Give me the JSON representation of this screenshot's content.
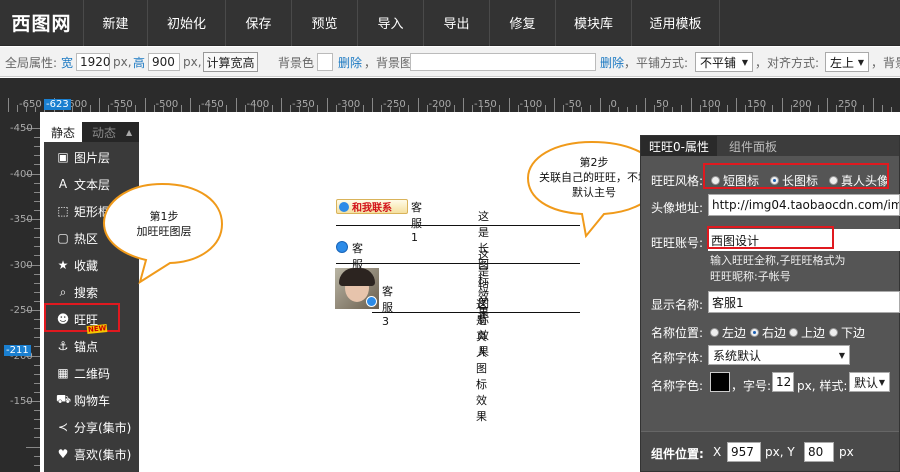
{
  "logo": "西图网",
  "menu": [
    "新建",
    "初始化",
    "保存",
    "预览",
    "导入",
    "导出",
    "修复",
    "模块库",
    "适用模板"
  ],
  "global": {
    "label": "全局属性:",
    "width_label": "宽",
    "width_value": "1920",
    "px1": "px,",
    "height_label": "高",
    "height_value": "900",
    "px2": "px,",
    "calc_button": "计算宽高",
    "bg_color_label": "背景色",
    "delete1": "删除",
    "bg_image_label": "，背景图",
    "delete2": "删除",
    "tile_label": "，平铺方式:",
    "tile_value": "不平铺",
    "align_label": "，对齐方式:",
    "align_value": "左上",
    "bg_tail": "，背景"
  },
  "hruler": {
    "labels": [
      "-650",
      "-600",
      "-550",
      "-500",
      "-450",
      "-400",
      "-350",
      "-300",
      "-250",
      "-200",
      "-150",
      "-100",
      "-50",
      "0",
      "50",
      "100",
      "150",
      "200",
      "250"
    ],
    "marker": "-623"
  },
  "vruler": {
    "labels": [
      "-450",
      "-400",
      "-350",
      "-300",
      "-250",
      "-200",
      "-150"
    ],
    "marker": "-211"
  },
  "layer_panel": {
    "tab_static": "静态",
    "tab_dynamic": "动态",
    "items": [
      {
        "icon": "image-icon",
        "glyph": "▣",
        "label": "图片层"
      },
      {
        "icon": "text-icon",
        "glyph": "A",
        "label": "文本层"
      },
      {
        "icon": "rect-frame-icon",
        "glyph": "⬚",
        "label": "矩形框"
      },
      {
        "icon": "hotzone-icon",
        "glyph": "▢",
        "label": "热区"
      },
      {
        "icon": "star-icon",
        "glyph": "★",
        "label": "收藏"
      },
      {
        "icon": "search-icon",
        "glyph": "⌕",
        "label": "搜索"
      },
      {
        "icon": "wangwang-icon",
        "glyph": "☻",
        "label": "旺旺"
      },
      {
        "icon": "anchor-icon",
        "glyph": "⚓",
        "label": "锚点"
      },
      {
        "icon": "qrcode-icon",
        "glyph": "▦",
        "label": "二维码"
      },
      {
        "icon": "cart-icon",
        "glyph": "⛟",
        "label": "购物车"
      },
      {
        "icon": "share-icon",
        "glyph": "≺",
        "label": "分享(集市)"
      },
      {
        "icon": "like-icon",
        "glyph": "♥",
        "label": "喜欢(集市)"
      }
    ],
    "new_badge": "NEW"
  },
  "bubble1": {
    "line1": "第1步",
    "line2": "加旺旺图层"
  },
  "bubble2": {
    "line1": "第2步",
    "line2": "关联自己的旺旺，不填",
    "line3": "默认主号"
  },
  "canvas": {
    "contact_button": "和我联系",
    "items": [
      {
        "name": "客服1",
        "desc": "这是长图标效果"
      },
      {
        "name": "客服2",
        "desc": "这是短图标效果"
      },
      {
        "name": "客服3",
        "desc": "这是真人图标效果"
      }
    ]
  },
  "prop_panel": {
    "tab_active": "旺旺0-属性",
    "tab_other": "组件面板",
    "style_label": "旺旺风格:",
    "style_options": [
      "短图标",
      "长图标",
      "真人头像"
    ],
    "style_selected": 1,
    "avatar_label": "头像地址:",
    "avatar_value": "http://img04.taobaocdn.com/im",
    "account_label": "旺旺账号:",
    "account_value": "西图设计",
    "hint1": "输入旺旺全称,子旺旺格式为",
    "hint2": "旺旺昵称:子帐号",
    "display_label": "显示名称:",
    "display_value": "客服1",
    "pos_label": "名称位置:",
    "pos_options": [
      "左边",
      "右边",
      "上边",
      "下边"
    ],
    "pos_selected": 1,
    "font_label": "名称字体:",
    "font_value": "系统默认",
    "color_label": "名称字色:",
    "size_label": "，字号:",
    "size_value": "12",
    "size_px": "px, 样式:",
    "style_value": "默认",
    "footer_label": "组件位置:",
    "x_label": "X",
    "x_value": "957",
    "x_px": "px, Y",
    "y_value": "80",
    "y_px": "px"
  }
}
